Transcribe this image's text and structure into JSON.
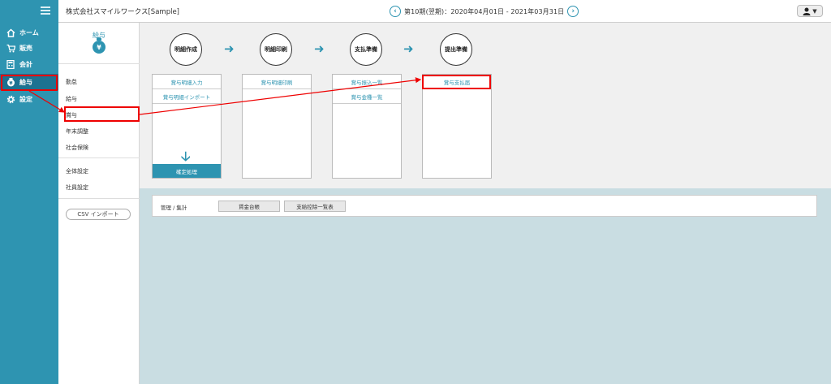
{
  "header": {
    "company": "株式会社スマイルワークス[Sample]",
    "period": "第10期(翌期)：2020年04月01日 - 2021年03月31日"
  },
  "leftnav": {
    "items": [
      {
        "label": "ホーム",
        "icon": "home-icon"
      },
      {
        "label": "販売",
        "icon": "cart-icon"
      },
      {
        "label": "会計",
        "icon": "calculator-icon"
      },
      {
        "label": "給与",
        "icon": "moneybag-icon"
      },
      {
        "label": "設定",
        "icon": "gear-icon"
      }
    ],
    "active": "給与"
  },
  "subnav": {
    "title": "給与",
    "moneybag_symbol": "¥",
    "items_group1": [
      "勤怠",
      "給与",
      "賞与",
      "年末調整",
      "社会保険"
    ],
    "items_group2": [
      "全体設定",
      "社員設定"
    ],
    "csv_button": "CSV インポート"
  },
  "steps": [
    {
      "label": "明細作成",
      "links": [
        "賞与明細入力",
        "賞与明細インポート"
      ],
      "confirm": "確定処理"
    },
    {
      "label": "明細印刷",
      "links": [
        "賞与明細印刷"
      ]
    },
    {
      "label": "支払準備",
      "links": [
        "賞与振込一覧",
        "賞与金種一覧"
      ]
    },
    {
      "label": "提出準備",
      "links": [
        "賞与支払届"
      ]
    }
  ],
  "management": {
    "label": "管理 / 集計",
    "buttons": [
      "賃金台帳",
      "支給控除一覧表"
    ]
  },
  "colors": {
    "accent": "#2e94b1",
    "annotation": "#e00000",
    "bottom_panel": "#c9dde2"
  }
}
